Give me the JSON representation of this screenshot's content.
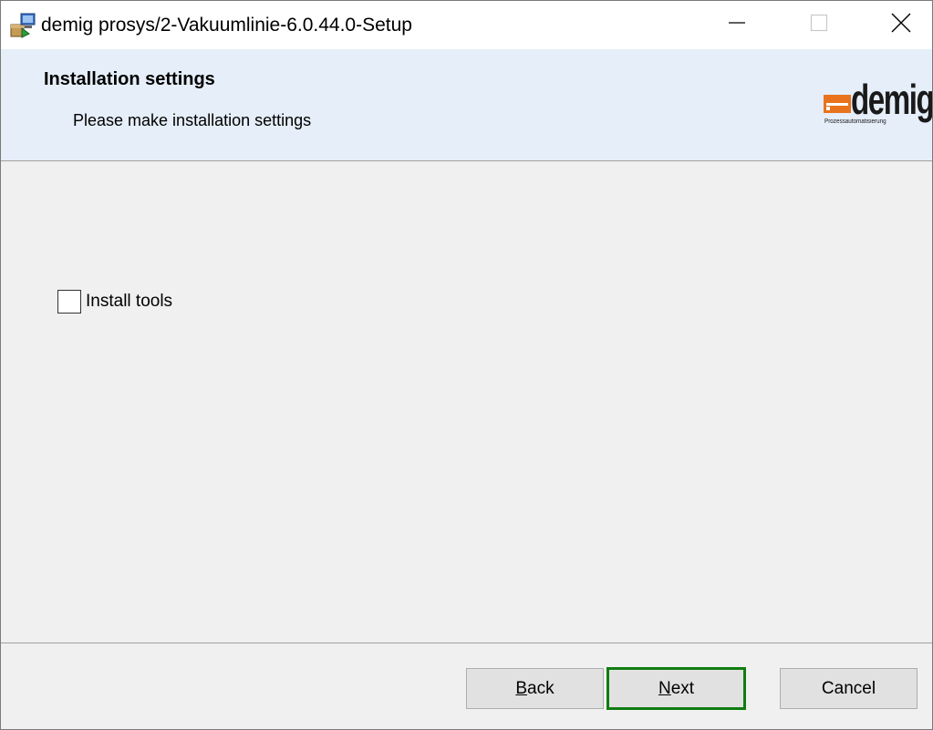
{
  "window": {
    "title": "demig prosys/2-Vakuumlinie-6.0.44.0-Setup",
    "icon": "installer-package-icon",
    "controls": {
      "minimize_icon": "minimize-icon",
      "maximize_icon": "maximize-icon",
      "close_icon": "close-icon"
    }
  },
  "banner": {
    "title": "Installation settings",
    "subtitle": "Please make installation settings",
    "logo": {
      "wordmark": "demig",
      "tagline": "Prozessautomatisierung",
      "accent_color": "#e8731c"
    }
  },
  "options": {
    "install_tools": {
      "label": "Install tools",
      "checked": false
    }
  },
  "buttons": {
    "back": {
      "mnemonic": "B",
      "rest": "ack"
    },
    "next": {
      "mnemonic": "N",
      "rest": "ext"
    },
    "cancel": "Cancel"
  },
  "colors": {
    "banner_bg": "#e5eef9",
    "dialog_bg": "#f0f0f0",
    "focus_border": "#107c10"
  }
}
